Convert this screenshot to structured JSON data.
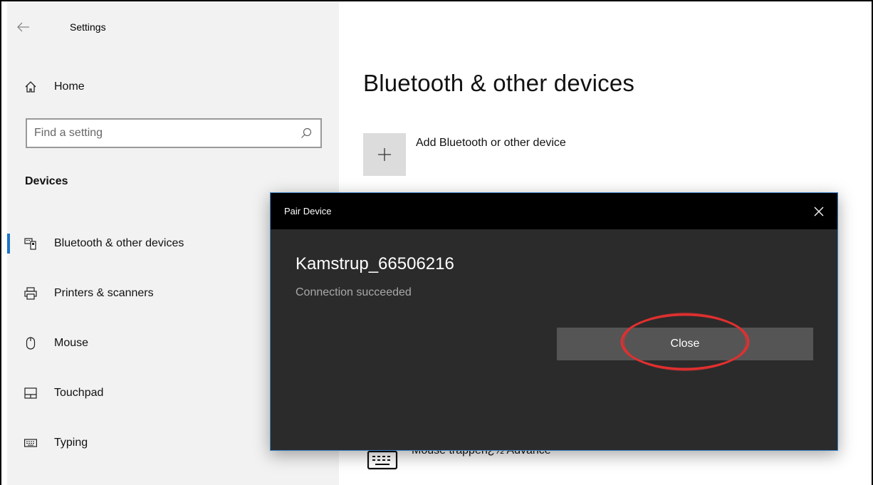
{
  "app": {
    "title": "Settings",
    "back_icon": "back-arrow-icon"
  },
  "sidebar": {
    "home_label": "Home",
    "search_placeholder": "Find a setting",
    "section_title": "Devices",
    "items": [
      {
        "label": "Bluetooth & other devices",
        "icon": "bluetooth-devices-icon",
        "active": true
      },
      {
        "label": "Printers & scanners",
        "icon": "printer-icon",
        "active": false
      },
      {
        "label": "Mouse",
        "icon": "mouse-icon",
        "active": false
      },
      {
        "label": "Touchpad",
        "icon": "touchpad-icon",
        "active": false
      },
      {
        "label": "Typing",
        "icon": "keyboard-icon",
        "active": false
      }
    ]
  },
  "main": {
    "page_title": "Bluetooth & other devices",
    "add_device_label": "Add Bluetooth or other device",
    "partial_device_label": "Mouse trappen¿½ Advance"
  },
  "dialog": {
    "title": "Pair Device",
    "device_name": "Kamstrup_66506216",
    "status": "Connection succeeded",
    "close_button_label": "Close"
  },
  "colors": {
    "accent": "#1a73c8",
    "dialog_bg": "#2b2b2b",
    "dialog_titlebar": "#000000",
    "button_bg": "#555555",
    "annotation_red": "#e03030"
  }
}
